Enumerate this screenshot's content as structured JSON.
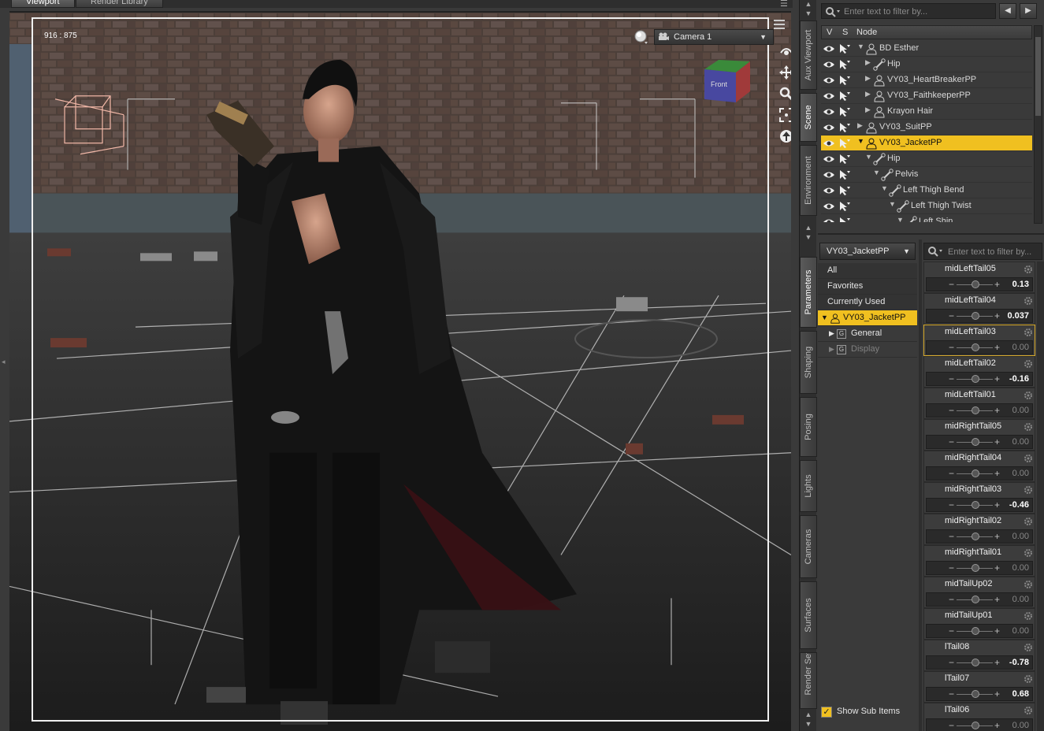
{
  "viewport_tabs": [
    {
      "label": "Viewport",
      "active": true
    },
    {
      "label": "Render Library",
      "active": false
    }
  ],
  "viewport": {
    "coords": "916 : 875",
    "camera": "Camera 1",
    "cube_label": "Front"
  },
  "side_tabs": [
    "Aux Viewport",
    "Scene",
    "Environment",
    "Parameters",
    "Shaping",
    "Posing",
    "Lights",
    "Cameras",
    "Surfaces",
    "Render Settings"
  ],
  "scene": {
    "search_placeholder": "Enter text to filter by...",
    "header": {
      "v": "V",
      "s": "S",
      "node": "Node"
    },
    "tree": [
      {
        "label": "BD Esther",
        "indent": 0,
        "expanded": true,
        "icon": "figure-icon"
      },
      {
        "label": "Hip",
        "indent": 1,
        "expanded": false,
        "icon": "bone-icon"
      },
      {
        "label": "VY03_HeartBreakerPP",
        "indent": 1,
        "expanded": false,
        "icon": "figure-icon"
      },
      {
        "label": "VY03_FaithkeeperPP",
        "indent": 1,
        "expanded": false,
        "icon": "figure-icon"
      },
      {
        "label": "Krayon Hair",
        "indent": 1,
        "expanded": false,
        "icon": "figure-icon"
      },
      {
        "label": "VY03_SuitPP",
        "indent": 0,
        "expanded": false,
        "icon": "figure-icon"
      },
      {
        "label": "VY03_JacketPP",
        "indent": 0,
        "expanded": true,
        "icon": "figure-icon",
        "selected": true
      },
      {
        "label": "Hip",
        "indent": 1,
        "expanded": true,
        "icon": "bone-icon"
      },
      {
        "label": "Pelvis",
        "indent": 2,
        "expanded": true,
        "icon": "bone-icon"
      },
      {
        "label": "Left Thigh Bend",
        "indent": 3,
        "expanded": true,
        "icon": "bone-icon"
      },
      {
        "label": "Left Thigh Twist",
        "indent": 4,
        "expanded": true,
        "icon": "bone-icon"
      },
      {
        "label": "Left Shin",
        "indent": 5,
        "expanded": true,
        "icon": "bone-icon"
      }
    ]
  },
  "parameters": {
    "node": "VY03_JacketPP",
    "search_placeholder": "Enter text to filter by...",
    "categories": [
      {
        "label": "All"
      },
      {
        "label": "Favorites"
      },
      {
        "label": "Currently Used"
      },
      {
        "label": "VY03_JacketPP",
        "selected": true
      },
      {
        "label": "General",
        "sub": true
      },
      {
        "label": "Display",
        "sub": true,
        "dim": true
      }
    ],
    "show_sub_items": "Show Sub Items",
    "sliders": [
      {
        "name": "midLeftTail05",
        "value": "0.13"
      },
      {
        "name": "midLeftTail04",
        "value": "0.037"
      },
      {
        "name": "midLeftTail03",
        "value": "0.00",
        "selected": true
      },
      {
        "name": "midLeftTail02",
        "value": "-0.16"
      },
      {
        "name": "midLeftTail01",
        "value": "0.00"
      },
      {
        "name": "midRightTail05",
        "value": "0.00"
      },
      {
        "name": "midRightTail04",
        "value": "0.00"
      },
      {
        "name": "midRightTail03",
        "value": "-0.46"
      },
      {
        "name": "midRightTail02",
        "value": "0.00"
      },
      {
        "name": "midRightTail01",
        "value": "0.00"
      },
      {
        "name": "midTailUp02",
        "value": "0.00"
      },
      {
        "name": "midTailUp01",
        "value": "0.00"
      },
      {
        "name": "lTail08",
        "value": "-0.78"
      },
      {
        "name": "lTail07",
        "value": "0.68"
      },
      {
        "name": "lTail06",
        "value": "0.00"
      }
    ]
  },
  "colors": {
    "selection": "#f0c020",
    "panel": "#3a3a3a"
  }
}
